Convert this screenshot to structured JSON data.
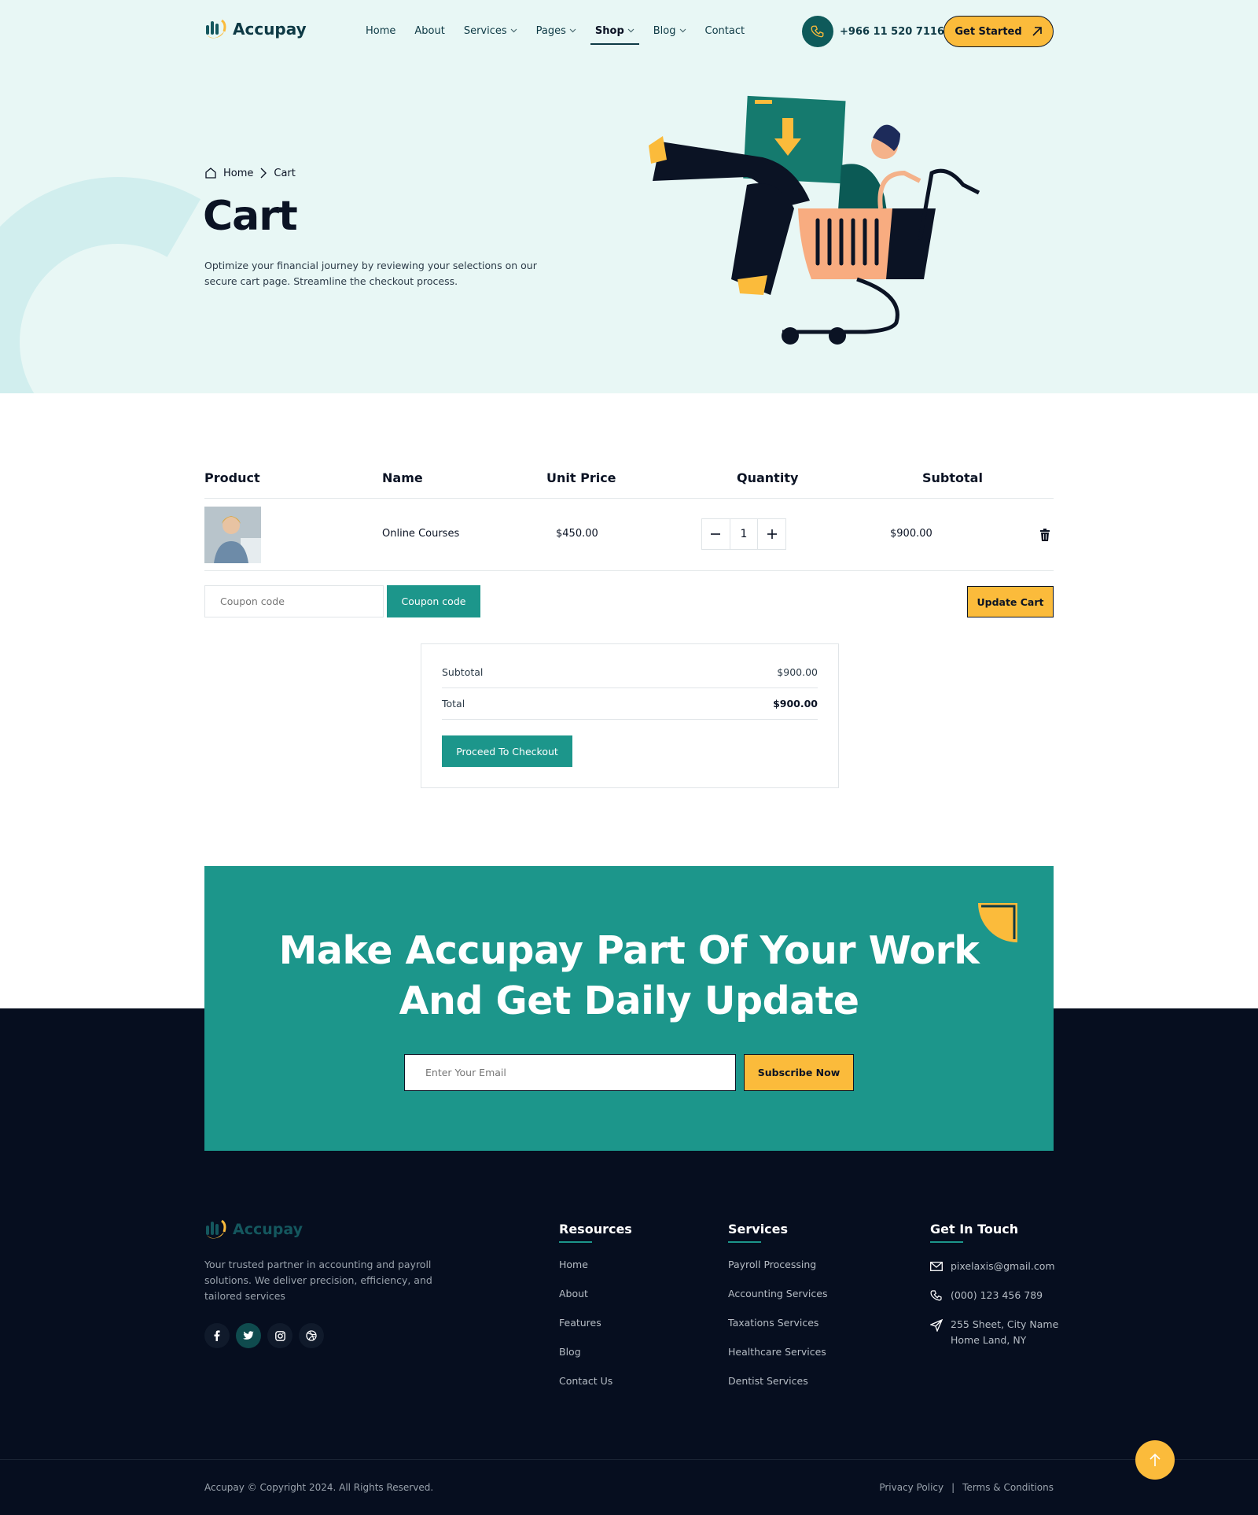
{
  "brand": {
    "name": "Accupay"
  },
  "nav": {
    "items": [
      {
        "label": "Home",
        "has_dropdown": false
      },
      {
        "label": "About",
        "has_dropdown": false
      },
      {
        "label": "Services",
        "has_dropdown": true
      },
      {
        "label": "Pages",
        "has_dropdown": true
      },
      {
        "label": "Shop",
        "has_dropdown": true,
        "active": true
      },
      {
        "label": "Blog",
        "has_dropdown": true
      },
      {
        "label": "Contact",
        "has_dropdown": false
      }
    ],
    "phone": "+966 11 520 7116",
    "cta_label": "Get Started"
  },
  "hero": {
    "breadcrumb": {
      "home": "Home",
      "current": "Cart"
    },
    "title": "Cart",
    "description": "Optimize your financial journey by reviewing your selections on our secure cart page. Streamline the checkout process."
  },
  "cart": {
    "headers": {
      "product": "Product",
      "name": "Name",
      "unit_price": "Unit Price",
      "quantity": "Quantity",
      "subtotal": "Subtotal"
    },
    "items": [
      {
        "name": "Online Courses",
        "unit_price": "$450.00",
        "quantity": "1",
        "subtotal": "$900.00"
      }
    ],
    "coupon_placeholder": "Coupon code",
    "coupon_button": "Coupon code",
    "update_button": "Update Cart"
  },
  "totals": {
    "subtotal_label": "Subtotal",
    "subtotal_value": "$900.00",
    "total_label": "Total",
    "total_value": "$900.00",
    "checkout_button": "Proceed To Checkout"
  },
  "newsletter": {
    "title_line1": "Make Accupay Part Of Your Work",
    "title_line2": "And Get Daily Update",
    "email_placeholder": "Enter Your Email",
    "subscribe_button": "Subscribe Now"
  },
  "footer": {
    "description": "Your trusted partner in accounting and payroll solutions. We deliver precision, efficiency, and tailored services",
    "socials": [
      "facebook-icon",
      "twitter-icon",
      "instagram-icon",
      "dribbble-icon"
    ],
    "resources": {
      "title": "Resources",
      "links": [
        "Home",
        "About",
        "Features",
        "Blog",
        "Contact Us"
      ]
    },
    "services": {
      "title": "Services",
      "links": [
        "Payroll Processing",
        "Accounting Services",
        "Taxations Services",
        "Healthcare Services",
        "Dentist Services"
      ]
    },
    "contact": {
      "title": "Get In Touch",
      "email": "pixelaxis@gmail.com",
      "phone": "(000) 123 456 789",
      "address_line1": "255 Sheet, City Name",
      "address_line2": "Home Land, NY"
    },
    "copyright": "Accupay © Copyright 2024. All Rights Reserved.",
    "privacy": "Privacy Policy",
    "separator": "|",
    "terms": "Terms & Conditions"
  },
  "colors": {
    "teal": "#1c968b",
    "yellow": "#fbbb3b",
    "navy": "#060e1f",
    "hero_bg": "#e8f7f5"
  }
}
